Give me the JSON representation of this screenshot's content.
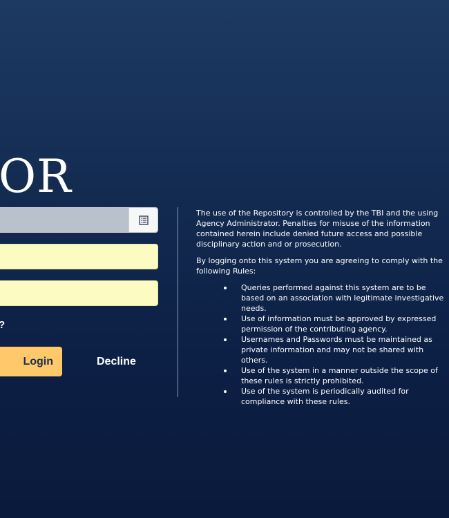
{
  "brand": {
    "title": "OR"
  },
  "form": {
    "agency_value": "",
    "username_value": "",
    "password_value": "",
    "forgot_text": "?",
    "login_label": "Login",
    "decline_label": "Decline"
  },
  "terms": {
    "paragraph1": "The use of the Repository is controlled by the TBI and the using Agency Administrator. Penalties for misuse of the information contained herein include denied future access and possible disciplinary action and or prosecution.",
    "paragraph2": "By logging onto this system you are agreeing to comply with the following Rules:",
    "rules": [
      "Queries performed against this system are to be based on an association with legitimate investigative needs.",
      "Use of information must be approved by expressed permission of the contributing agency.",
      "Usernames and Passwords must be maintained as private information and may not be shared with others.",
      "Use of the system in a manner outside the scope of these rules is strictly prohibited.",
      "Use of the system is periodically audited for compliance with these rules."
    ]
  },
  "icons": {
    "agency_list": "list-icon"
  },
  "colors": {
    "background_top": "#1d3a63",
    "background_bottom": "#0a1a3c",
    "agency_field": "#b9c1cc",
    "input_field": "#fcfcc2",
    "login_button": "#ffc96b",
    "login_text": "#1a2c4e"
  }
}
